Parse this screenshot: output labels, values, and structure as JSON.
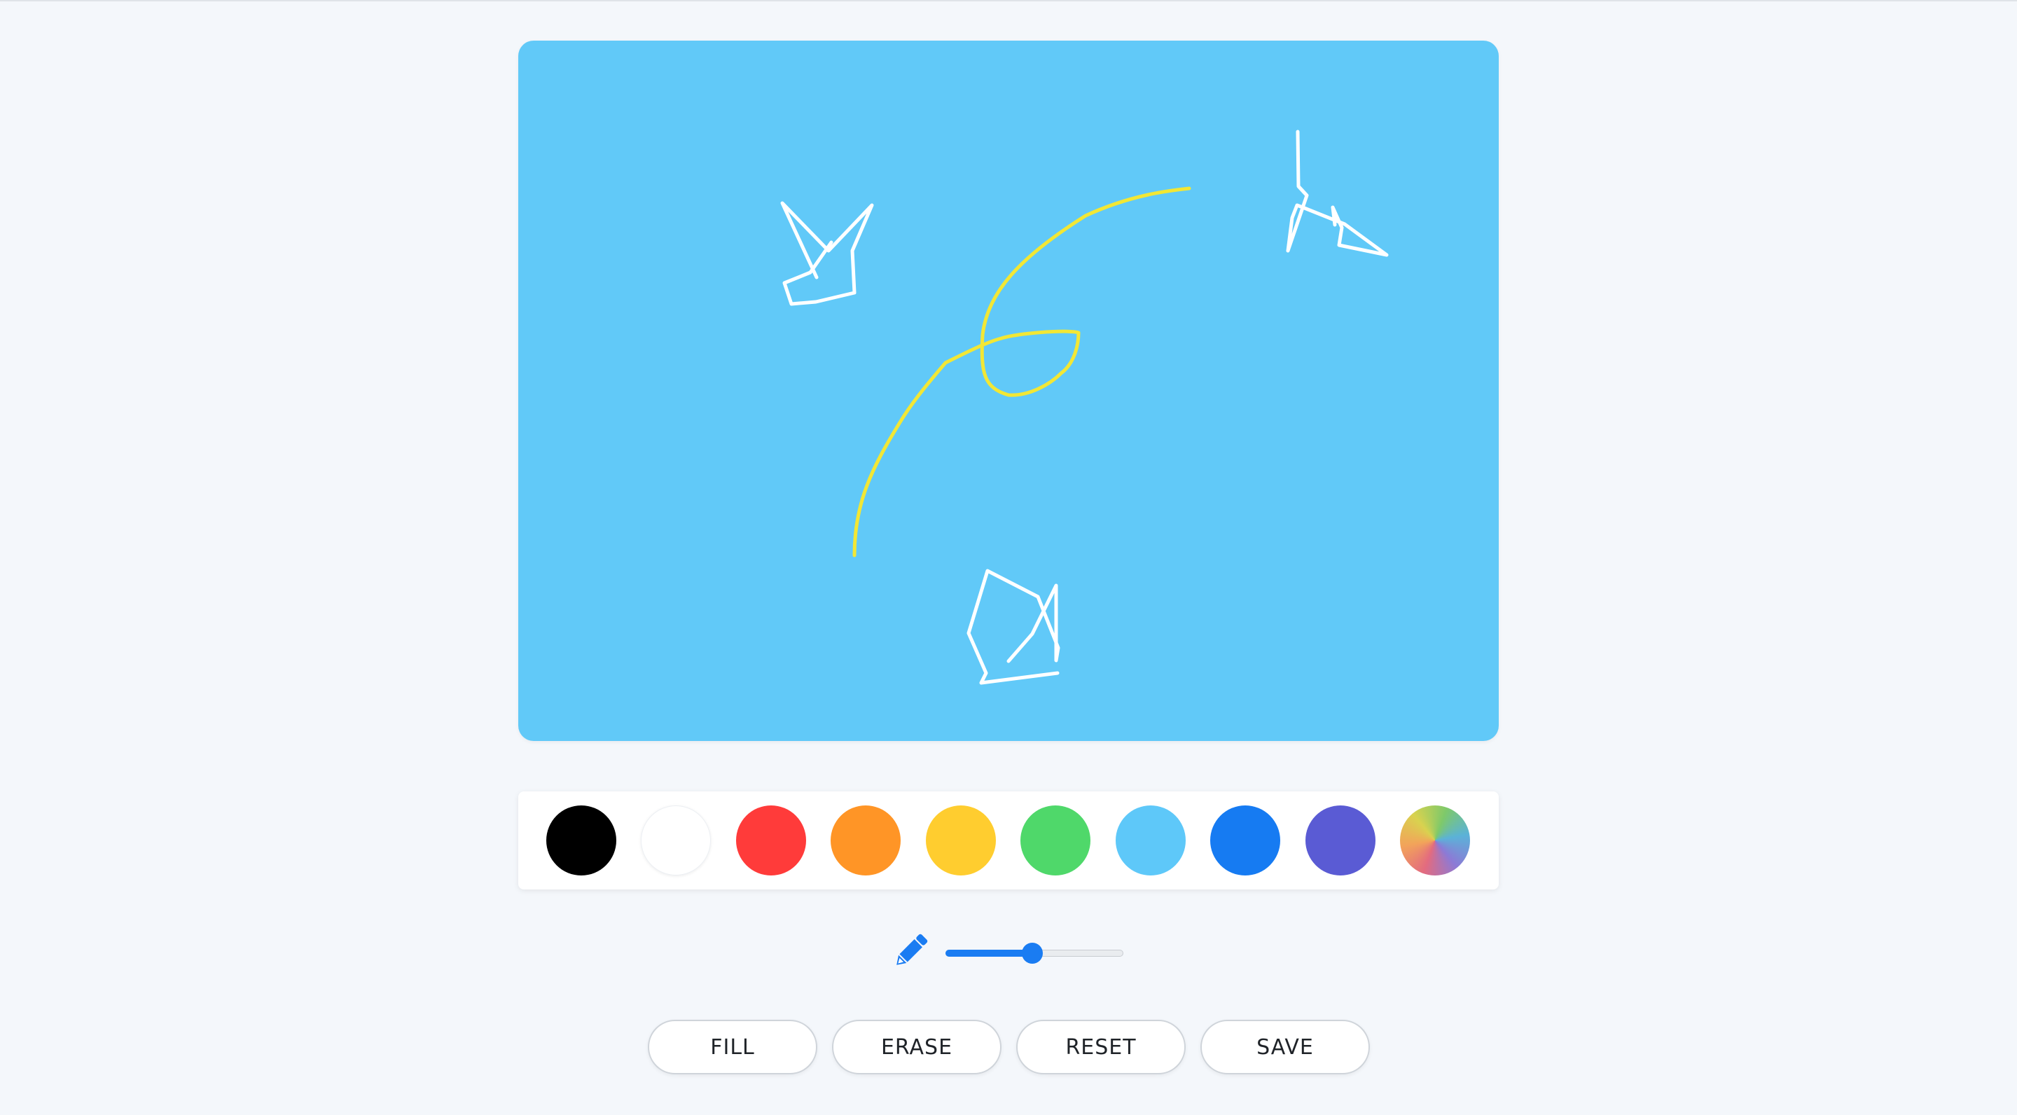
{
  "canvas": {
    "background": "#61c9f8",
    "stroke_colors": {
      "stars": "#ffffff",
      "curve": "#f2e735"
    }
  },
  "palette": {
    "colors": [
      {
        "name": "black",
        "hex": "#000000"
      },
      {
        "name": "white",
        "hex": "#ffffff"
      },
      {
        "name": "red",
        "hex": "#ff3b3a"
      },
      {
        "name": "orange",
        "hex": "#ff9526"
      },
      {
        "name": "yellow",
        "hex": "#ffcd2f"
      },
      {
        "name": "green",
        "hex": "#4fd86a"
      },
      {
        "name": "light-blue",
        "hex": "#5ec8f9"
      },
      {
        "name": "blue",
        "hex": "#167bf2"
      },
      {
        "name": "purple",
        "hex": "#5a5bd4"
      },
      {
        "name": "rainbow",
        "hex": "gradient"
      }
    ]
  },
  "brush": {
    "icon": "pencil-icon",
    "accent": "#1a7cf2",
    "size_fraction": 0.49
  },
  "buttons": {
    "fill_label": "FILL",
    "erase_label": "ERASE",
    "reset_label": "RESET",
    "save_label": "SAVE"
  }
}
